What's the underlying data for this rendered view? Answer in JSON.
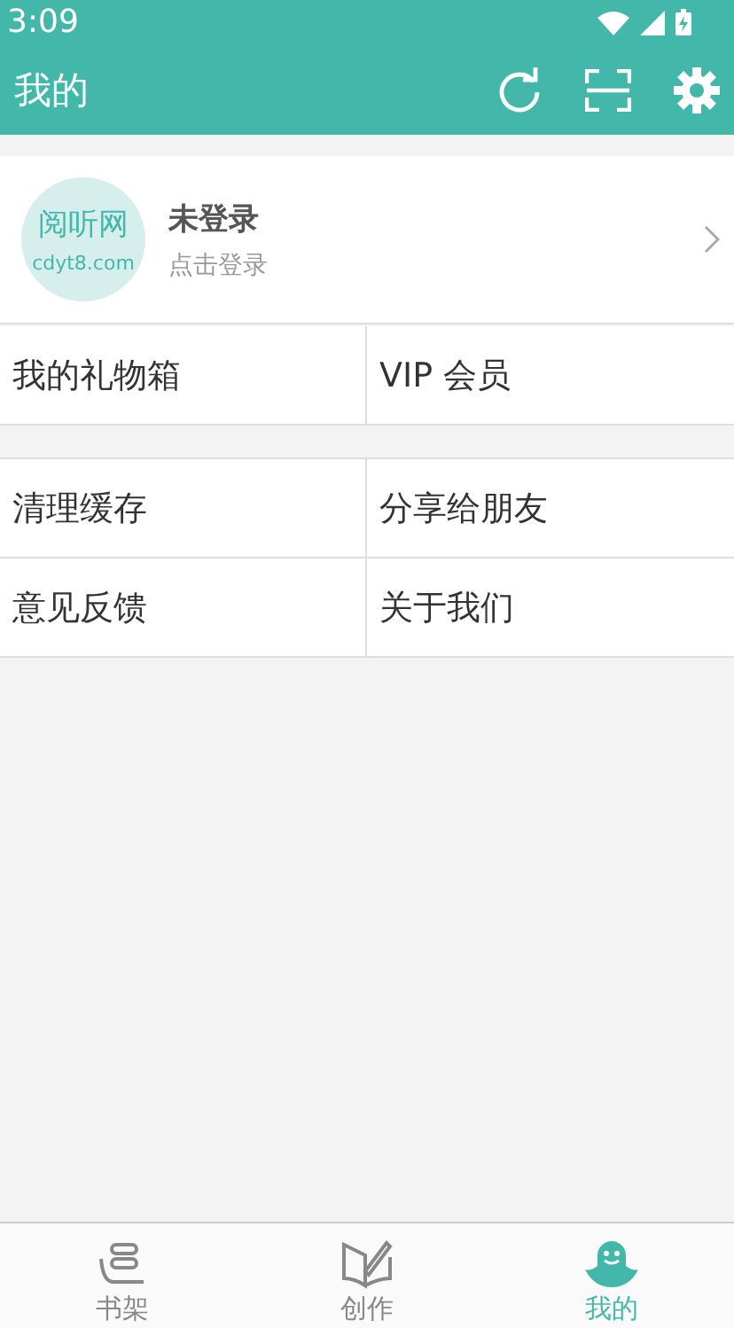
{
  "status_bar": {
    "time": "3:09"
  },
  "app_bar": {
    "title": "我的"
  },
  "profile": {
    "avatar_title": "阅听网",
    "avatar_subtitle": "cdyt8.com",
    "name": "未登录",
    "hint": "点击登录"
  },
  "menu_groups": [
    [
      {
        "label": "我的礼物箱"
      },
      {
        "label": "VIP 会员"
      }
    ],
    [
      {
        "label": "清理缓存"
      },
      {
        "label": "分享给朋友"
      },
      {
        "label": "意见反馈"
      },
      {
        "label": "关于我们"
      }
    ]
  ],
  "tabs": [
    {
      "kind": "shelf",
      "label": "书架",
      "selected": false
    },
    {
      "kind": "create",
      "label": "创作",
      "selected": false
    },
    {
      "kind": "me",
      "label": "我的",
      "selected": true
    }
  ]
}
